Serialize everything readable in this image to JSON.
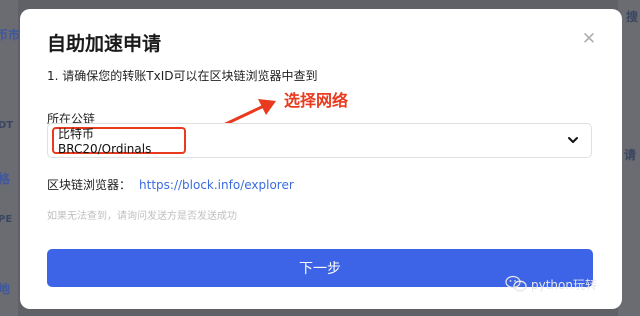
{
  "background": {
    "left_fragments": [
      "币市",
      "DT",
      "格",
      "PE",
      "地"
    ],
    "right_fragments": [
      "搜",
      "请"
    ]
  },
  "modal": {
    "title": "自助加速申请",
    "close_icon": "close-icon",
    "tip": "1. 请确保您的转账TxID可以在区块链浏览器中查到",
    "annotation": "选择网络",
    "chain_label": "所在公链",
    "chain_value": "比特币 BRC20/Ordinals",
    "explorer_label": "区块链浏览器：",
    "explorer_url": "https://block.info/explorer",
    "hint": "如果无法查到，请询问发送方是否发送成功",
    "next_button": "下一步"
  },
  "watermark": {
    "text": "python玩转"
  },
  "colors": {
    "accent": "#3d63e6",
    "annotation": "#e83a1e",
    "link": "#3a6ce0"
  }
}
